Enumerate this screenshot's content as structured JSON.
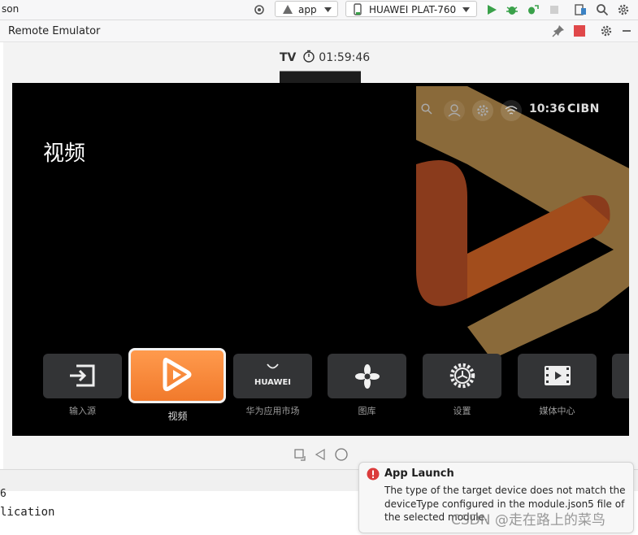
{
  "toolbar": {
    "left_text": "son",
    "app_selector": "app",
    "device_selector": "HUAWEI PLAT-760"
  },
  "panel": {
    "title": "Remote Emulator"
  },
  "emulator": {
    "status_tv": "TV",
    "status_time": "01:59:46"
  },
  "tv": {
    "clock": "10:36",
    "brand": "CIBN",
    "page_title": "视频",
    "tiles": [
      {
        "label": "输入源",
        "icon": "input-source-icon"
      },
      {
        "label": "视频",
        "icon": "video-play-icon"
      },
      {
        "label": "华为应用市场",
        "icon": "huawei-appgallery-icon",
        "brand": "HUAWEI"
      },
      {
        "label": "图库",
        "icon": "gallery-flower-icon"
      },
      {
        "label": "设置",
        "icon": "settings-gear-icon"
      },
      {
        "label": "媒体中心",
        "icon": "media-film-icon"
      }
    ]
  },
  "bottom": {
    "line1": "6",
    "line2": "lication"
  },
  "notification": {
    "title": "App Launch",
    "body": "The type of the target device does not match the deviceType configured in the module.json5 file of the selected module."
  },
  "watermark": "CSDN @走在路上的菜鸟",
  "colors": {
    "accent_orange": "#f17a2c",
    "run_green": "#3aa14a",
    "error_red": "#db3b3b",
    "stop_red": "#e0484a"
  }
}
